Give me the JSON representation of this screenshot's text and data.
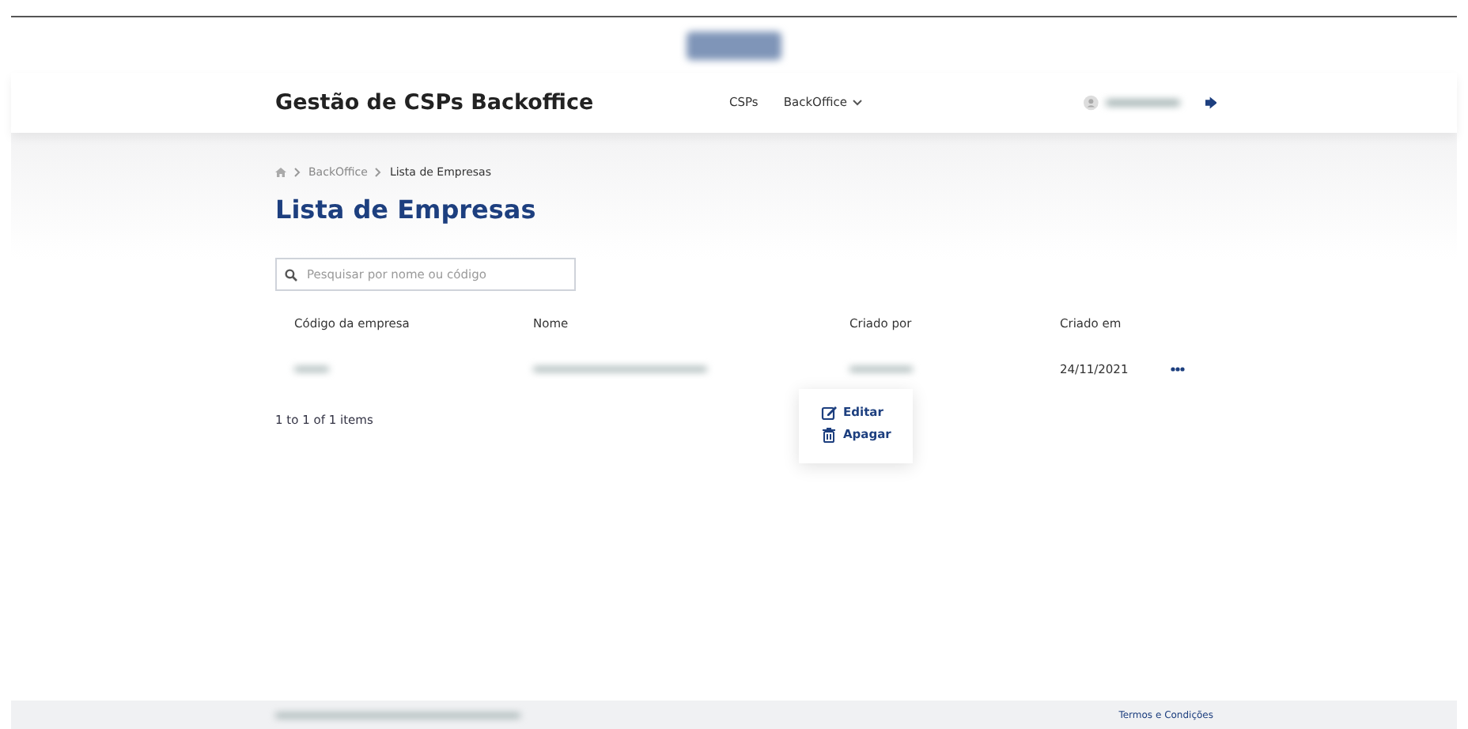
{
  "header": {
    "title": "Gestão de CSPs Backoffice",
    "nav": [
      {
        "label": "CSPs",
        "dropdown": false
      },
      {
        "label": "BackOffice",
        "dropdown": true
      }
    ]
  },
  "breadcrumb": [
    "BackOffice",
    "Lista de Empresas"
  ],
  "page_title": "Lista de Empresas",
  "search": {
    "placeholder": "Pesquisar por nome ou código"
  },
  "table": {
    "columns": [
      "Código da empresa",
      "Nome",
      "Criado por",
      "Criado em"
    ],
    "rows": [
      {
        "created_on": "24/11/2021"
      }
    ]
  },
  "pagination": "1 to 1 of 1 items",
  "row_menu": [
    {
      "label": "Editar",
      "kind": "edit"
    },
    {
      "label": "Apagar",
      "kind": "delete"
    }
  ],
  "footer": {
    "link": "Termos e Condições"
  }
}
